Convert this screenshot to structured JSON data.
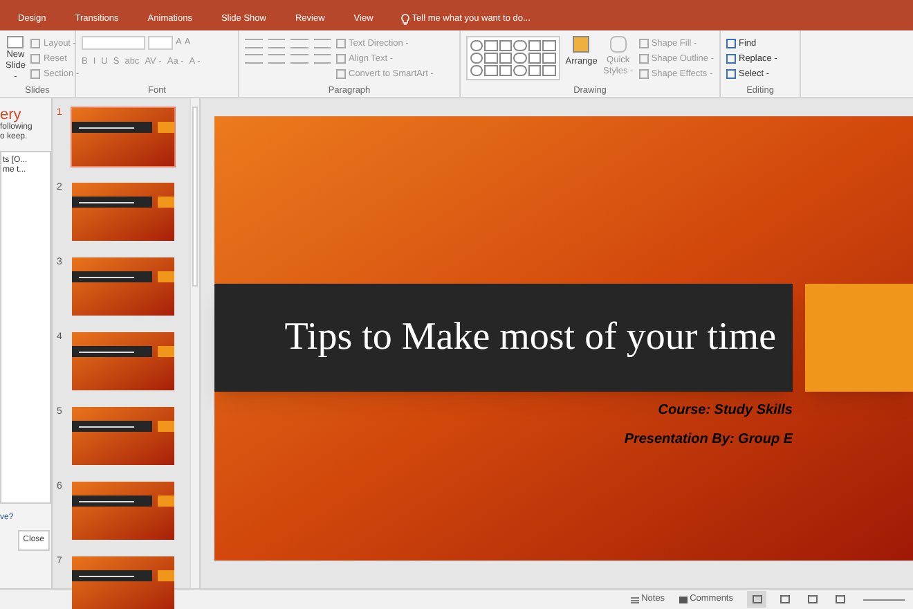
{
  "tabs": [
    {
      "label": "Design",
      "selected": false
    },
    {
      "label": "Transitions",
      "selected": false
    },
    {
      "label": "Animations",
      "selected": false
    },
    {
      "label": "Slide Show",
      "selected": false
    },
    {
      "label": "Review",
      "selected": false
    },
    {
      "label": "View",
      "selected": false
    }
  ],
  "tell_me": {
    "placeholder": "Tell me what you want to do..."
  },
  "ribbon": {
    "slides": {
      "new_slide": [
        "New",
        "Slide -"
      ],
      "items": [
        "Layout -",
        "Reset",
        "Section -"
      ],
      "label": "Slides"
    },
    "font": {
      "buttons": [
        "B",
        "I",
        "U",
        "S",
        "abc",
        "AV -",
        "Aa -",
        "A -"
      ],
      "grow": [
        "A",
        "A"
      ],
      "label": "Font"
    },
    "paragraph": {
      "items": [
        "Text Direction -",
        "Align Text -",
        "Convert to SmartArt -"
      ],
      "label": "Paragraph"
    },
    "drawing": {
      "arrange": "Arrange",
      "quick_styles": "Quick Styles -",
      "items": [
        "Shape Fill -",
        "Shape Outline -",
        "Shape Effects -"
      ],
      "label": "Drawing"
    },
    "editing": {
      "items": [
        "Find",
        "Replace -",
        "Select -"
      ],
      "label": "Editing"
    }
  },
  "recovery_pane": {
    "title": "ery",
    "text": "following\no keep.",
    "files": [
      "ts [O...",
      "me t..."
    ],
    "link": "ve?",
    "close": "Close"
  },
  "thumbnails": [
    {
      "number": "1",
      "selected": true
    },
    {
      "number": "2",
      "selected": false
    },
    {
      "number": "3",
      "selected": false
    },
    {
      "number": "4",
      "selected": false
    },
    {
      "number": "5",
      "selected": false
    },
    {
      "number": "6",
      "selected": false
    },
    {
      "number": "7",
      "selected": false
    }
  ],
  "slide": {
    "title": "Tips to Make most of your time",
    "subtitle": [
      "Course: Study Skills",
      "Presentation By: Group E"
    ]
  },
  "status_bar": {
    "notes": "Notes",
    "comments": "Comments"
  }
}
